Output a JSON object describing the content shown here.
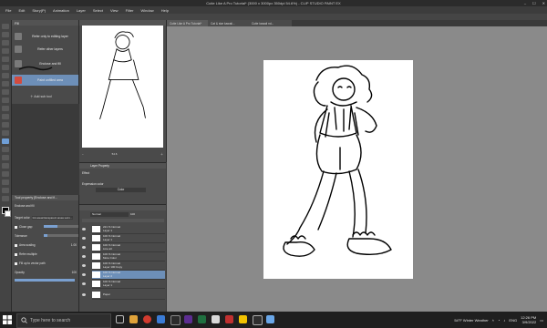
{
  "window": {
    "title": "Cutie Like A Pro Tutorial* (3000 x 3000px 350dpi 54.6%) - CLIP STUDIO PAINT EX",
    "controls": [
      "–",
      "☐",
      "✕"
    ]
  },
  "menu": [
    "File",
    "Edit",
    "Story(P)",
    "Animation",
    "Layer",
    "Select",
    "View",
    "Filter",
    "Window",
    "Help"
  ],
  "subtool": {
    "tab": "Fill",
    "items": [
      {
        "label": "Refer only to editing layer",
        "selected": false
      },
      {
        "label": "Refer other layers",
        "selected": false
      },
      {
        "label": "Enclose and fill",
        "selected": false
      },
      {
        "label": "Paint unfilled area",
        "selected": true
      }
    ],
    "add_label": "Add sub tool"
  },
  "tool_property": {
    "header": "Tool property [Enclose and fi...",
    "tool_name": "Enclose and fill",
    "rows": [
      {
        "label": "Target color",
        "value": "Ink areas/transparent areas surro..."
      },
      {
        "label": "Close gap",
        "value": ""
      },
      {
        "label": "Tolerance",
        "value": ""
      },
      {
        "label": "Area scaling",
        "value": "1.00"
      },
      {
        "label": "Refer multiple",
        "value": ""
      },
      {
        "label": "Fill up to vector path",
        "value": ""
      },
      {
        "label": "Opacity",
        "value": "100"
      }
    ]
  },
  "layer_property": {
    "header": "Layer Property",
    "effect_label": "Effect",
    "expression_label": "Expression color",
    "expression_value": "Color"
  },
  "layers": {
    "blend_mode": "Normal",
    "opacity": "100",
    "rows": [
      {
        "name": "Layer 1",
        "mode": "221 % Normal"
      },
      {
        "name": "Layer 1",
        "mode": "100 % Normal"
      },
      {
        "name": "Line art",
        "mode": "100 % Normal"
      },
      {
        "name": "More Color",
        "mode": "100 % Normal"
      },
      {
        "name": "Layer 100 Copy",
        "mode": "100 % Normal"
      },
      {
        "name": "Layer 2",
        "mode": "100 % Normal",
        "selected": true
      },
      {
        "name": "Layer 1",
        "mode": "100 % Normal"
      },
      {
        "name": "Paper",
        "mode": ""
      }
    ]
  },
  "canvas_tabs": [
    {
      "label": "Cutie Like A Pro Tutorial*",
      "active": true
    },
    {
      "label": "Cat & star kawaii...",
      "active": false
    },
    {
      "label": "Cutie kawaii nd...",
      "active": false
    }
  ],
  "navigator": {
    "zoom": "54.6"
  },
  "taskbar": {
    "search_placeholder": "Type here to search",
    "weather": "54°F  Winter Weather",
    "lang": "ENG",
    "time": "12:26 PM",
    "date": "3/9/2022"
  },
  "colors": {
    "accent": "#6d8fb8",
    "panel": "#4a4a4a",
    "workspace": "#8a8a8a"
  }
}
